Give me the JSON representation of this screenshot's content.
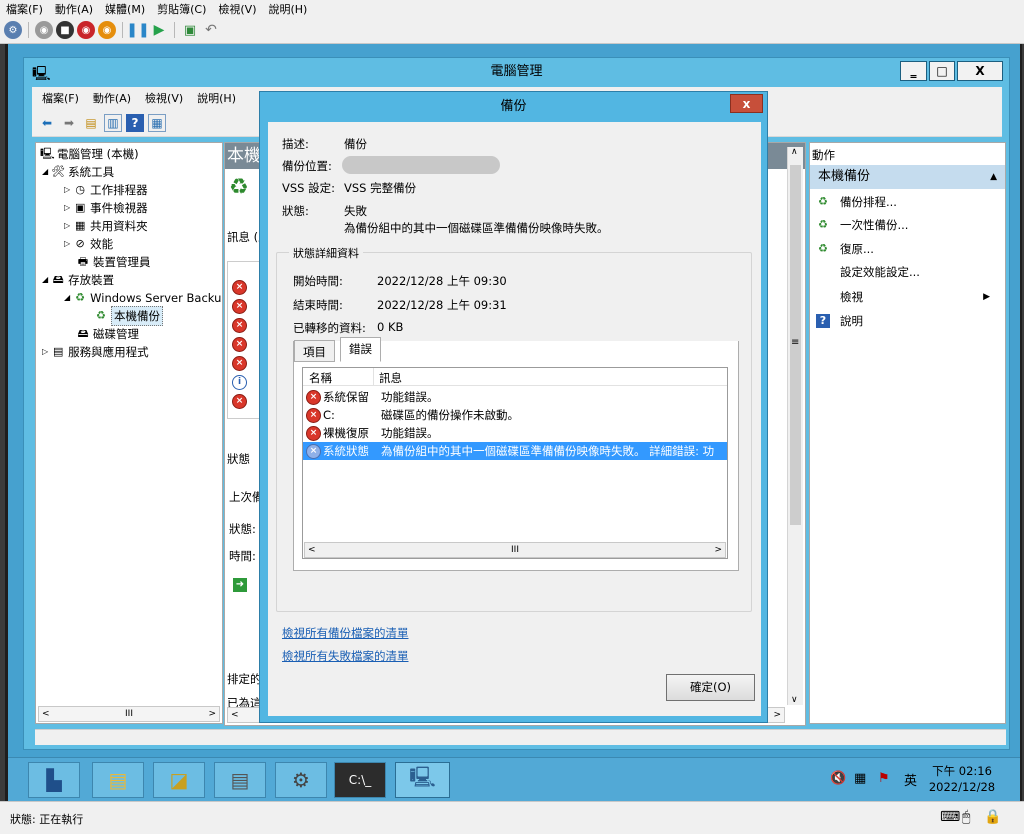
{
  "vm": {
    "menu": [
      "檔案(F)",
      "動作(A)",
      "媒體(M)",
      "剪貼簿(C)",
      "檢視(V)",
      "說明(H)"
    ]
  },
  "main": {
    "title": "電腦管理",
    "menu": [
      "檔案(F)",
      "動作(A)",
      "檢視(V)",
      "說明(H)"
    ],
    "minimize": "‗",
    "maximize": "□",
    "close": "X"
  },
  "tree": {
    "items": [
      "電腦管理 (本機)",
      "系統工具",
      "工作排程器",
      "事件檢視器",
      "共用資料夾",
      "效能",
      "裝置管理員",
      "存放裝置",
      "Windows Server Backu",
      "本機備份",
      "磁碟管理",
      "服務與應用程式"
    ]
  },
  "center": {
    "header": "本機",
    "info": "訊息 (上",
    "status": "狀態",
    "last": "上次備",
    "stat_label": "狀態:",
    "time_label": "時間:",
    "sched": "排定的",
    "already": "已為這",
    "rowmark": "2"
  },
  "actions": {
    "header": "動作",
    "group": "本機備份",
    "items": [
      "備份排程...",
      "一次性備份...",
      "復原...",
      "設定效能設定...",
      "檢視",
      "說明"
    ]
  },
  "dialog": {
    "title": "備份",
    "close": "x",
    "desc_label": "描述:",
    "desc": "備份",
    "loc_label": "備份位置:",
    "vss_label": "VSS 設定:",
    "vss": "VSS 完整備份",
    "status_label": "狀態:",
    "status": "失敗",
    "status_detail": "為備份組中的其中一個磁碟區準備備份映像時失敗。",
    "detail_group": "狀態詳細資料",
    "start_label": "開始時間:",
    "start": "2022/12/28 上午 09:30",
    "end_label": "結束時間:",
    "end": "2022/12/28 上午 09:31",
    "transferred_label": "已轉移的資料:",
    "transferred": "0 KB",
    "tabs": [
      "項目",
      "錯誤"
    ],
    "columns": [
      "名稱",
      "訊息"
    ],
    "errors": [
      {
        "name": "系統保留",
        "message": "功能錯誤。"
      },
      {
        "name": "C:",
        "message": "磁碟區的備份操作未啟動。"
      },
      {
        "name": "裸機復原",
        "message": "功能錯誤。"
      },
      {
        "name": "系統狀態",
        "message": "為備份組中的其中一個磁碟區準備備份映像時失敗。  詳細錯誤: 功"
      }
    ],
    "scroll_mid": "III",
    "link1": "檢視所有備份檔案的清單",
    "link2": "檢視所有失敗檔案的清單",
    "ok": "確定(O)"
  },
  "taskbar": {
    "time": "下午 02:16",
    "date": "2022/12/28",
    "ime": "英"
  },
  "bottom": {
    "status": "狀態: 正在執行"
  }
}
